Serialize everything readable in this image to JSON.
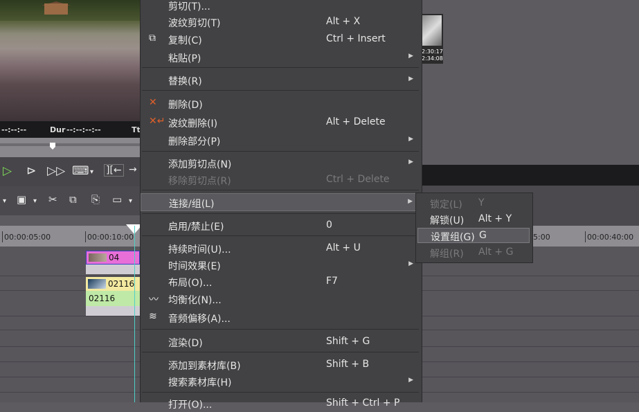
{
  "preview": {
    "timecode_left": "--:--:--",
    "dur_label": "Dur",
    "dur_value": "--:--:--:--",
    "tt_label": "Tt"
  },
  "thumb": {
    "time1": "2:30:17",
    "time2": "2:34:08"
  },
  "ruler": {
    "ticks": [
      "00:00:05:00",
      "00:00:10:00",
      "5:00",
      "00:00:40:00"
    ]
  },
  "clips": {
    "clip1": "04",
    "clip2": "02116",
    "clip3": "02116"
  },
  "menu": {
    "items": [
      {
        "label": "剪切(T)...",
        "shortcut": "",
        "arrow": false,
        "icon": "",
        "disabled": false
      },
      {
        "label": "波纹剪切(T)",
        "shortcut": "Alt + X",
        "arrow": false,
        "icon": "",
        "disabled": false
      },
      {
        "label": "复制(C)",
        "shortcut": "Ctrl + Insert",
        "arrow": false,
        "icon": "copy-icon",
        "disabled": false
      },
      {
        "label": "粘贴(P)",
        "shortcut": "",
        "arrow": true,
        "icon": "",
        "disabled": false
      },
      {
        "label": "替换(R)",
        "shortcut": "",
        "arrow": true,
        "icon": "",
        "disabled": false
      },
      {
        "label": "删除(D)",
        "shortcut": "",
        "arrow": false,
        "icon": "delete-icon",
        "disabled": false
      },
      {
        "label": "波纹删除(I)",
        "shortcut": "Alt + Delete",
        "arrow": false,
        "icon": "ripple-delete-icon",
        "disabled": false
      },
      {
        "label": "删除部分(P)",
        "shortcut": "",
        "arrow": true,
        "icon": "",
        "disabled": false
      },
      {
        "label": "添加剪切点(N)",
        "shortcut": "",
        "arrow": true,
        "icon": "",
        "disabled": false
      },
      {
        "label": "移除剪切点(R)",
        "shortcut": "Ctrl + Delete",
        "arrow": false,
        "icon": "",
        "disabled": true
      },
      {
        "label": "连接/组(L)",
        "shortcut": "",
        "arrow": true,
        "icon": "",
        "disabled": false
      },
      {
        "label": "启用/禁止(E)",
        "shortcut": "0",
        "arrow": false,
        "icon": "",
        "disabled": false
      },
      {
        "label": "持续时间(U)...",
        "shortcut": "Alt + U",
        "arrow": false,
        "icon": "",
        "disabled": false
      },
      {
        "label": "时间效果(E)",
        "shortcut": "",
        "arrow": true,
        "icon": "",
        "disabled": false
      },
      {
        "label": "布局(O)...",
        "shortcut": "F7",
        "arrow": false,
        "icon": "",
        "disabled": false
      },
      {
        "label": "均衡化(N)...",
        "shortcut": "",
        "arrow": false,
        "icon": "equalize-icon",
        "disabled": false
      },
      {
        "label": "音频偏移(A)...",
        "shortcut": "",
        "arrow": false,
        "icon": "audio-offset-icon",
        "disabled": false
      },
      {
        "label": "渲染(D)",
        "shortcut": "Shift + G",
        "arrow": false,
        "icon": "",
        "disabled": false
      },
      {
        "label": "添加到素材库(B)",
        "shortcut": "Shift + B",
        "arrow": false,
        "icon": "",
        "disabled": false
      },
      {
        "label": "搜索素材库(H)",
        "shortcut": "",
        "arrow": true,
        "icon": "",
        "disabled": false
      },
      {
        "label": "打开(O)...",
        "shortcut": "Shift + Ctrl + P",
        "arrow": false,
        "icon": "",
        "disabled": false
      }
    ]
  },
  "submenu": {
    "items": [
      {
        "label": "锁定(L)",
        "shortcut": "Y",
        "disabled": true
      },
      {
        "label": "解锁(U)",
        "shortcut": "Alt + Y",
        "disabled": false
      },
      {
        "label": "设置组(G)",
        "shortcut": "G",
        "disabled": false
      },
      {
        "label": "解组(R)",
        "shortcut": "Alt + G",
        "disabled": true
      }
    ]
  },
  "colors": {
    "menu_bg": "#424244",
    "highlight": "#5a5a5e",
    "clip_pink": "#e86fd8",
    "clip_yellow": "#f3e9a0",
    "clip_green": "#bfe9a6",
    "playhead": "#4fd0c8"
  }
}
